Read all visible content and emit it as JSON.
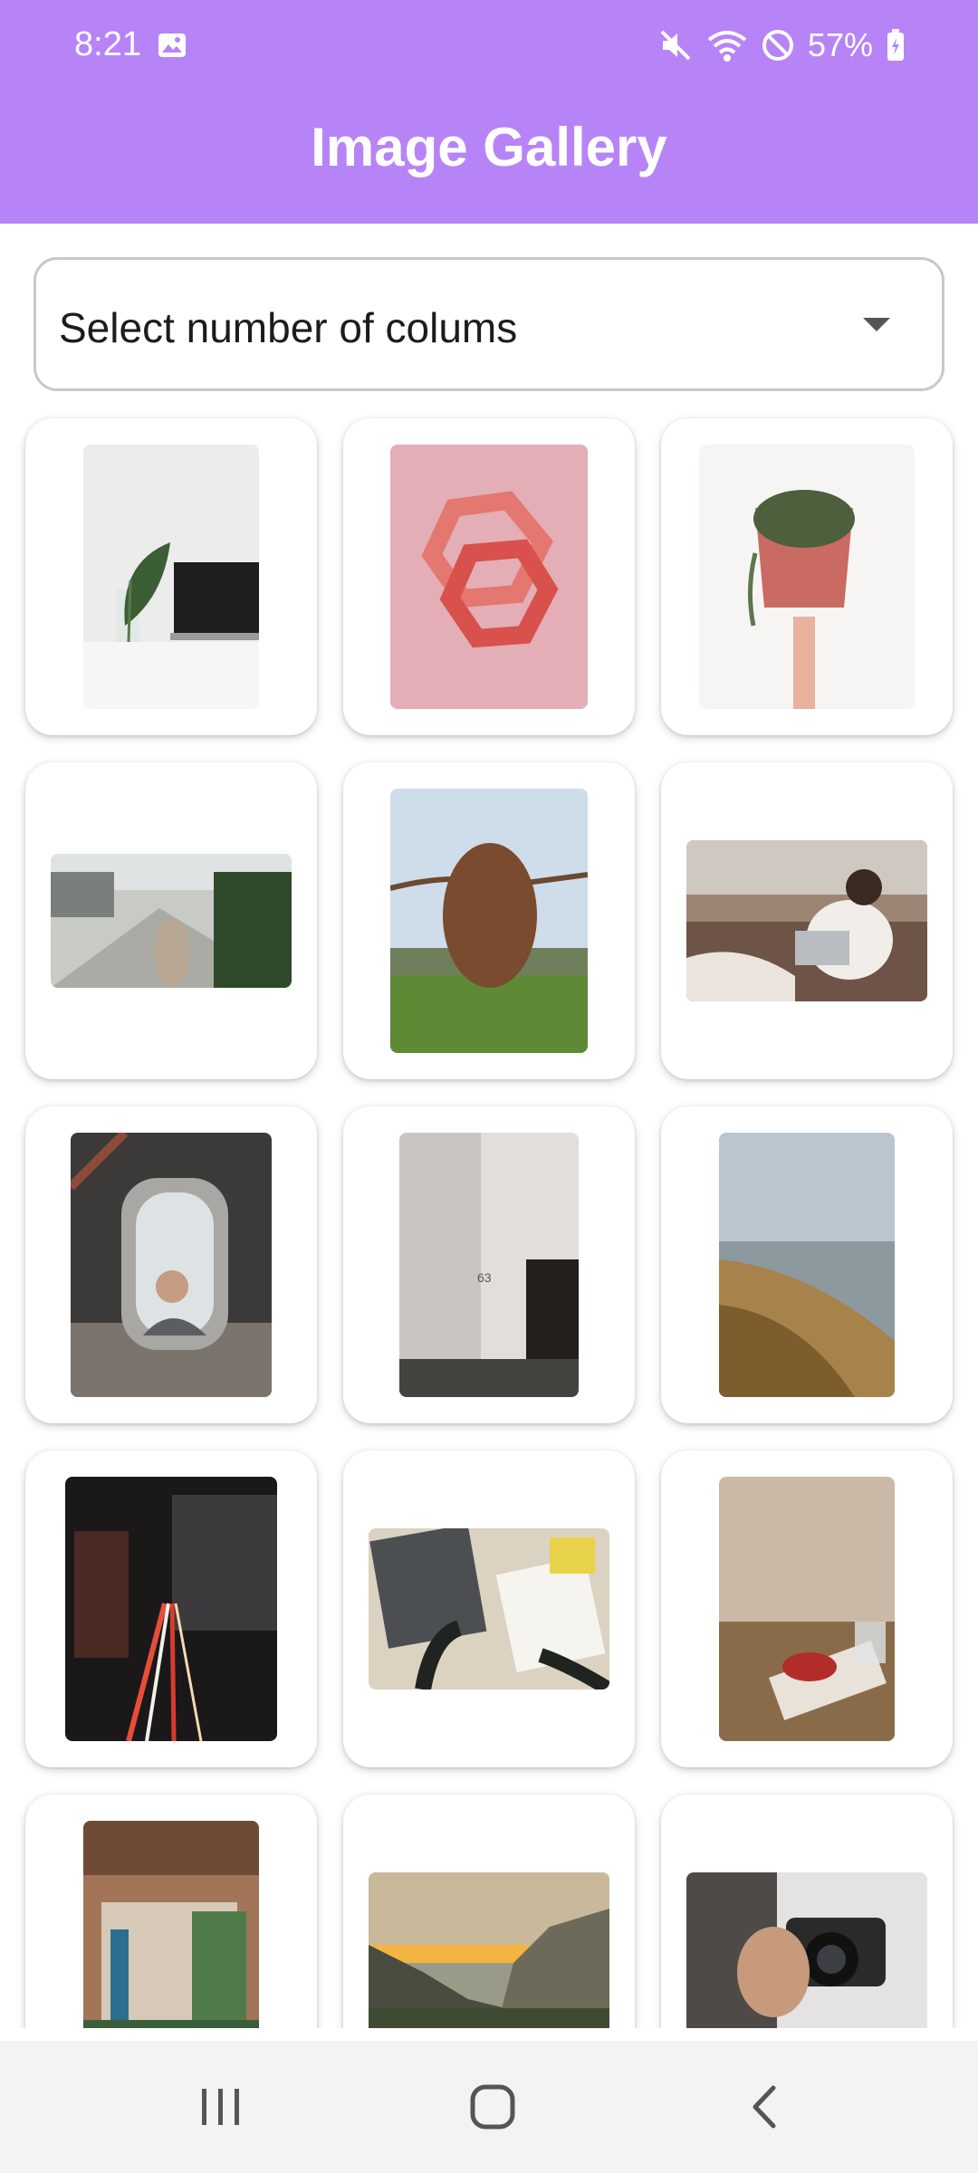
{
  "status_bar": {
    "time": "8:21",
    "battery_percent": "57%",
    "icons": [
      "gallery-icon",
      "mute-icon",
      "wifi-icon",
      "do-not-disturb-icon",
      "battery-charging-icon"
    ]
  },
  "app_bar": {
    "title": "Image Gallery",
    "background": "#b784f7"
  },
  "column_select": {
    "placeholder": "Select number of colums",
    "icon": "dropdown-arrow-icon"
  },
  "gallery": {
    "columns": 3,
    "images": [
      {
        "name": "plant-leaf-laptop-image"
      },
      {
        "name": "pink-geometric-rings-image"
      },
      {
        "name": "hand-holding-plant-pot-image"
      },
      {
        "name": "city-street-woman-image"
      },
      {
        "name": "highland-cow-image"
      },
      {
        "name": "woman-on-couch-laptop-image"
      },
      {
        "name": "woman-in-mirror-frame-image"
      },
      {
        "name": "concrete-building-corner-image"
      },
      {
        "name": "beach-dune-grass-image"
      },
      {
        "name": "night-city-light-trails-image"
      },
      {
        "name": "laptop-notebook-desk-image"
      },
      {
        "name": "coffee-cup-tray-image"
      },
      {
        "name": "modern-interior-plants-image"
      },
      {
        "name": "valley-sunset-mountains-image"
      },
      {
        "name": "hand-holding-camera-image"
      }
    ]
  },
  "nav_bar": {
    "icons": [
      "recent-apps-icon",
      "home-icon",
      "back-icon"
    ]
  }
}
